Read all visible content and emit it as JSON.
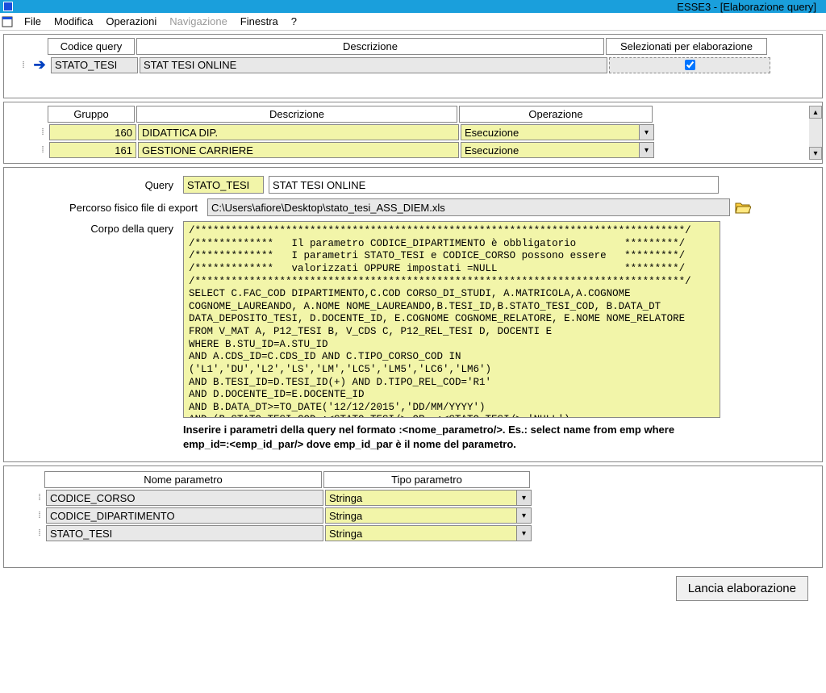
{
  "titlebar": {
    "text": "ESSE3 - [Elaborazione query]"
  },
  "menu": {
    "file": "File",
    "modifica": "Modifica",
    "operazioni": "Operazioni",
    "navigazione": "Navigazione",
    "finestra": "Finestra",
    "help": "?"
  },
  "queryGrid": {
    "headers": {
      "code": "Codice query",
      "desc": "Descrizione",
      "selected": "Selezionati per elaborazione"
    },
    "row": {
      "code": "STATO_TESI",
      "desc": "STAT TESI ONLINE"
    }
  },
  "groupGrid": {
    "headers": {
      "group": "Gruppo",
      "desc": "Descrizione",
      "op": "Operazione"
    },
    "rows": [
      {
        "group": "160",
        "desc": "DIDATTICA DIP.",
        "op": "Esecuzione"
      },
      {
        "group": "161",
        "desc": "GESTIONE CARRIERE",
        "op": "Esecuzione"
      }
    ]
  },
  "form": {
    "queryLabel": "Query",
    "queryCode": "STATO_TESI",
    "queryDesc": "STAT TESI ONLINE",
    "exportLabel": "Percorso fisico file di export",
    "exportPath": "C:\\Users\\afiore\\Desktop\\stato_tesi_ASS_DIEM.xls",
    "bodyLabel": "Corpo della query",
    "body": "/*********************************************************************************/\n/*************   Il parametro CODICE_DIPARTIMENTO è obbligatorio        *********/\n/*************   I parametri STATO_TESI e CODICE_CORSO possono essere   *********/\n/*************   valorizzati OPPURE impostati =NULL                     *********/\n/*********************************************************************************/\nSELECT C.FAC_COD DIPARTIMENTO,C.COD CORSO_DI_STUDI, A.MATRICOLA,A.COGNOME\nCOGNOME_LAUREANDO, A.NOME NOME_LAUREANDO,B.TESI_ID,B.STATO_TESI_COD, B.DATA_DT\nDATA_DEPOSITO_TESI, D.DOCENTE_ID, E.COGNOME COGNOME_RELATORE, E.NOME NOME_RELATORE\nFROM V_MAT A, P12_TESI B, V_CDS C, P12_REL_TESI D, DOCENTI E\nWHERE B.STU_ID=A.STU_ID\nAND A.CDS_ID=C.CDS_ID AND C.TIPO_CORSO_COD IN\n('L1','DU','L2','LS','LM','LC5','LM5','LC6','LM6')\nAND B.TESI_ID=D.TESI_ID(+) AND D.TIPO_REL_COD='R1'\nAND D.DOCENTE_ID=E.DOCENTE_ID\nAND B.DATA_DT>=TO_DATE('12/12/2015','DD/MM/YYYY')\nAND (B.STATO_TESI_COD=:<STATO_TESI/> OR  :<STATO_TESI/>='NULL')",
    "hint": "Inserire i parametri della query nel formato :<nome_parametro/>.        Es.: select name from emp where emp_id=:<emp_id_par/> dove emp_id_par è il nome del parametro."
  },
  "params": {
    "headers": {
      "name": "Nome parametro",
      "type": "Tipo parametro"
    },
    "rows": [
      {
        "name": "CODICE_CORSO",
        "type": "Stringa"
      },
      {
        "name": "CODICE_DIPARTIMENTO",
        "type": "Stringa"
      },
      {
        "name": "STATO_TESI",
        "type": "Stringa"
      }
    ]
  },
  "launch": "Lancia elaborazione"
}
